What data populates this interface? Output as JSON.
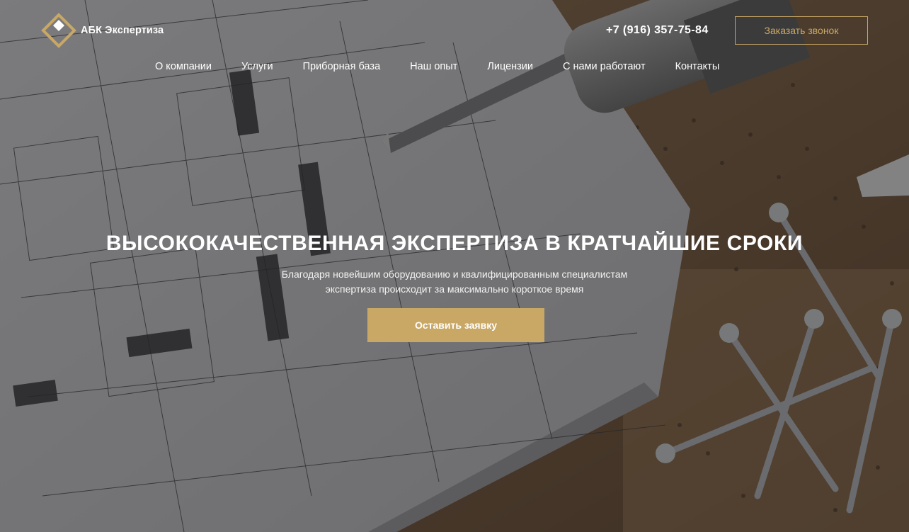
{
  "brand": {
    "name": "АБК Экспертиза",
    "accent_color": "#c9a866"
  },
  "header": {
    "phone": "+7 (916) 357-75-84",
    "callback_button": "Заказать звонок"
  },
  "nav": {
    "items": [
      {
        "label": "О компании"
      },
      {
        "label": "Услуги"
      },
      {
        "label": "Приборная база"
      },
      {
        "label": "Наш опыт"
      },
      {
        "label": "Лицензии"
      },
      {
        "label": "С нами работают"
      },
      {
        "label": "Контакты"
      }
    ]
  },
  "hero": {
    "title": "ВЫСОКОКАЧЕСТВЕННАЯ ЭКСПЕРТИЗА В КРАТЧАЙШИЕ СРОКИ",
    "subtitle_line1": "Благодаря новейшим оборудованию и квалифицированным специалистам",
    "subtitle_line2": "экспертиза происходит за максимально короткое время",
    "cta_button": "Оставить заявку"
  }
}
